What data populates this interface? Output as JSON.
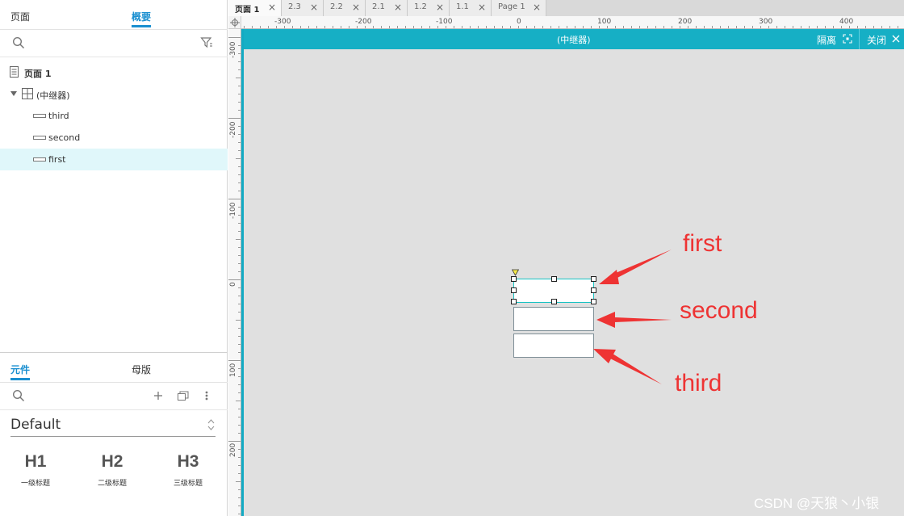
{
  "left_panel": {
    "top_tabs": [
      "页面",
      "概要"
    ],
    "outline": [
      {
        "label": "页面 1",
        "icon": "page-icon"
      },
      {
        "label": "(中继器)",
        "icon": "repeater-icon"
      },
      {
        "label": "third",
        "icon": "textbox-icon"
      },
      {
        "label": "second",
        "icon": "textbox-icon"
      },
      {
        "label": "first",
        "icon": "textbox-icon",
        "selected": true
      }
    ],
    "lib_tabs": [
      "元件",
      "母版"
    ],
    "library": "Default",
    "headings": [
      {
        "title": "H1",
        "caption": "一级标题"
      },
      {
        "title": "H2",
        "caption": "二级标题"
      },
      {
        "title": "H3",
        "caption": "三级标题"
      }
    ]
  },
  "doc_tabs": [
    {
      "label": "页面 1",
      "active": true
    },
    {
      "label": "2.3"
    },
    {
      "label": "2.2"
    },
    {
      "label": "2.1"
    },
    {
      "label": "1.2"
    },
    {
      "label": "1.1"
    },
    {
      "label": "Page 1"
    }
  ],
  "close_glyph": "×",
  "ruler": {
    "h_labels": [
      "-300",
      "-200",
      "-100",
      "0",
      "100",
      "200",
      "300",
      "400"
    ],
    "v_labels": [
      "-300",
      "-200",
      "-100",
      "0",
      "100",
      "200"
    ]
  },
  "repeater_bar": {
    "title": "(中继器)",
    "isolate_label": "隔离",
    "close_label": "关闭"
  },
  "repeater_items": [
    "first",
    "second",
    "third"
  ],
  "annotations": [
    "first",
    "second",
    "third"
  ],
  "watermark": "CSDN @天狼丶小银",
  "colors": {
    "accent": "#1a8fd0",
    "repeater_bar": "#16afc5",
    "annotation": "#ee3333",
    "selection": "#e0f7fa"
  }
}
